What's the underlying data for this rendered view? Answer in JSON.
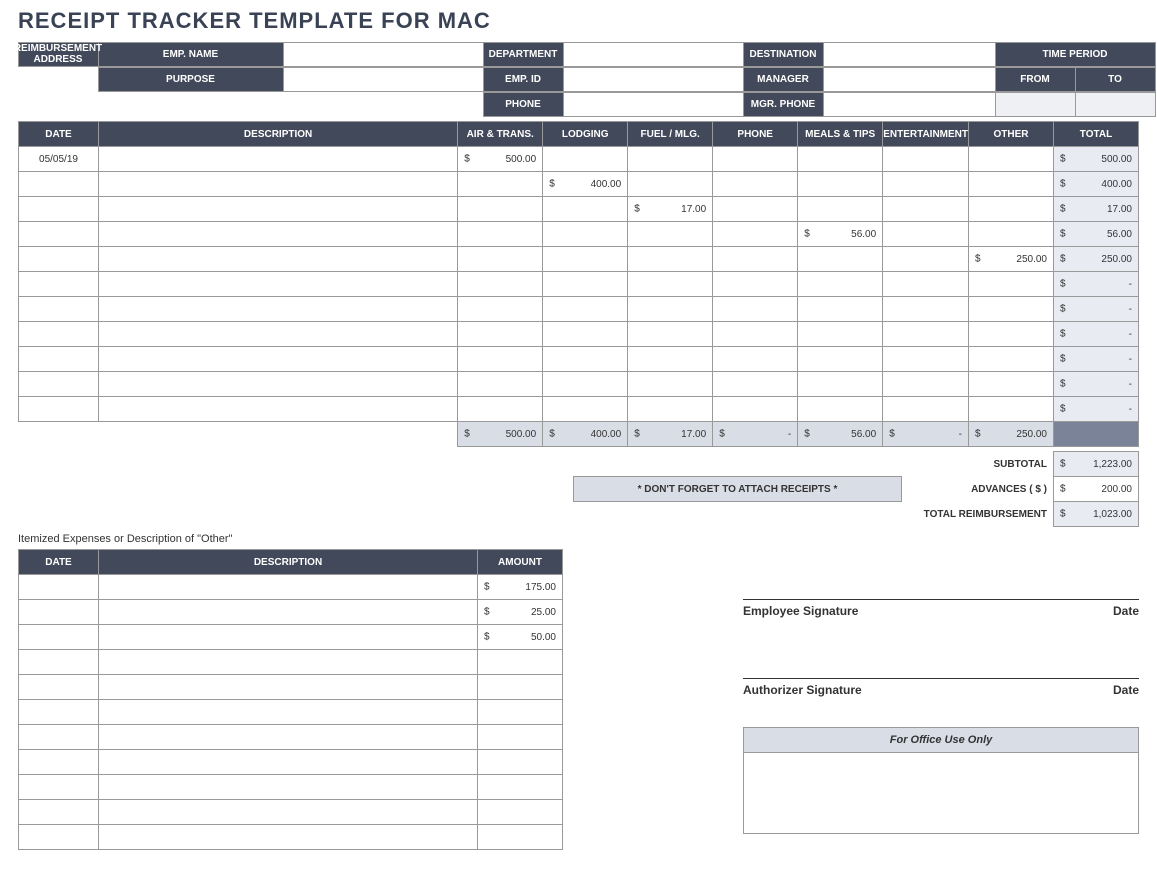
{
  "title": "RECEIPT TRACKER TEMPLATE FOR MAC",
  "header": {
    "emp_name_label": "EMP. NAME",
    "emp_id_label": "EMP. ID",
    "phone_label": "PHONE",
    "reimb_addr_label": "REIMBURSEMENT ADDRESS",
    "department_label": "DEPARTMENT",
    "manager_label": "MANAGER",
    "mgr_phone_label": "MGR. PHONE",
    "destination_label": "DESTINATION",
    "purpose_label": "PURPOSE",
    "time_period_label": "TIME PERIOD",
    "from_label": "FROM",
    "to_label": "TO"
  },
  "expense_headers": [
    "DATE",
    "DESCRIPTION",
    "AIR & TRANS.",
    "LODGING",
    "FUEL / MLG.",
    "PHONE",
    "MEALS & TIPS",
    "ENTERTAINMENT",
    "OTHER",
    "TOTAL"
  ],
  "expense_rows": [
    {
      "date": "05/05/19",
      "desc": "",
      "air": "500.00",
      "lodging": "",
      "fuel": "",
      "phone": "",
      "meals": "",
      "ent": "",
      "other": "",
      "total": "500.00"
    },
    {
      "date": "",
      "desc": "",
      "air": "",
      "lodging": "400.00",
      "fuel": "",
      "phone": "",
      "meals": "",
      "ent": "",
      "other": "",
      "total": "400.00"
    },
    {
      "date": "",
      "desc": "",
      "air": "",
      "lodging": "",
      "fuel": "17.00",
      "phone": "",
      "meals": "",
      "ent": "",
      "other": "",
      "total": "17.00"
    },
    {
      "date": "",
      "desc": "",
      "air": "",
      "lodging": "",
      "fuel": "",
      "phone": "",
      "meals": "56.00",
      "ent": "",
      "other": "",
      "total": "56.00"
    },
    {
      "date": "",
      "desc": "",
      "air": "",
      "lodging": "",
      "fuel": "",
      "phone": "",
      "meals": "",
      "ent": "",
      "other": "250.00",
      "total": "250.00"
    },
    {
      "date": "",
      "desc": "",
      "air": "",
      "lodging": "",
      "fuel": "",
      "phone": "",
      "meals": "",
      "ent": "",
      "other": "",
      "total": "-"
    },
    {
      "date": "",
      "desc": "",
      "air": "",
      "lodging": "",
      "fuel": "",
      "phone": "",
      "meals": "",
      "ent": "",
      "other": "",
      "total": "-"
    },
    {
      "date": "",
      "desc": "",
      "air": "",
      "lodging": "",
      "fuel": "",
      "phone": "",
      "meals": "",
      "ent": "",
      "other": "",
      "total": "-"
    },
    {
      "date": "",
      "desc": "",
      "air": "",
      "lodging": "",
      "fuel": "",
      "phone": "",
      "meals": "",
      "ent": "",
      "other": "",
      "total": "-"
    },
    {
      "date": "",
      "desc": "",
      "air": "",
      "lodging": "",
      "fuel": "",
      "phone": "",
      "meals": "",
      "ent": "",
      "other": "",
      "total": "-"
    },
    {
      "date": "",
      "desc": "",
      "air": "",
      "lodging": "",
      "fuel": "",
      "phone": "",
      "meals": "",
      "ent": "",
      "other": "",
      "total": "-"
    }
  ],
  "column_totals": {
    "air": "500.00",
    "lodging": "400.00",
    "fuel": "17.00",
    "phone": "-",
    "meals": "56.00",
    "ent": "-",
    "other": "250.00"
  },
  "reminder": "* DON'T FORGET TO ATTACH RECEIPTS *",
  "summary": {
    "subtotal_label": "SUBTOTAL",
    "subtotal": "1,223.00",
    "advances_label": "ADVANCES  ( $ )",
    "advances": "200.00",
    "total_label": "TOTAL REIMBURSEMENT",
    "total": "1,023.00"
  },
  "itemized_note": "Itemized Expenses or Description of \"Other\"",
  "itemized_headers": [
    "DATE",
    "DESCRIPTION",
    "AMOUNT"
  ],
  "itemized_rows": [
    {
      "date": "",
      "desc": "",
      "amount": "175.00"
    },
    {
      "date": "",
      "desc": "",
      "amount": "25.00"
    },
    {
      "date": "",
      "desc": "",
      "amount": "50.00"
    },
    {
      "date": "",
      "desc": "",
      "amount": ""
    },
    {
      "date": "",
      "desc": "",
      "amount": ""
    },
    {
      "date": "",
      "desc": "",
      "amount": ""
    },
    {
      "date": "",
      "desc": "",
      "amount": ""
    },
    {
      "date": "",
      "desc": "",
      "amount": ""
    },
    {
      "date": "",
      "desc": "",
      "amount": ""
    },
    {
      "date": "",
      "desc": "",
      "amount": ""
    },
    {
      "date": "",
      "desc": "",
      "amount": ""
    }
  ],
  "signatures": {
    "employee_label": "Employee Signature",
    "authorizer_label": "Authorizer Signature",
    "date_label": "Date"
  },
  "office_use_label": "For Office Use Only"
}
